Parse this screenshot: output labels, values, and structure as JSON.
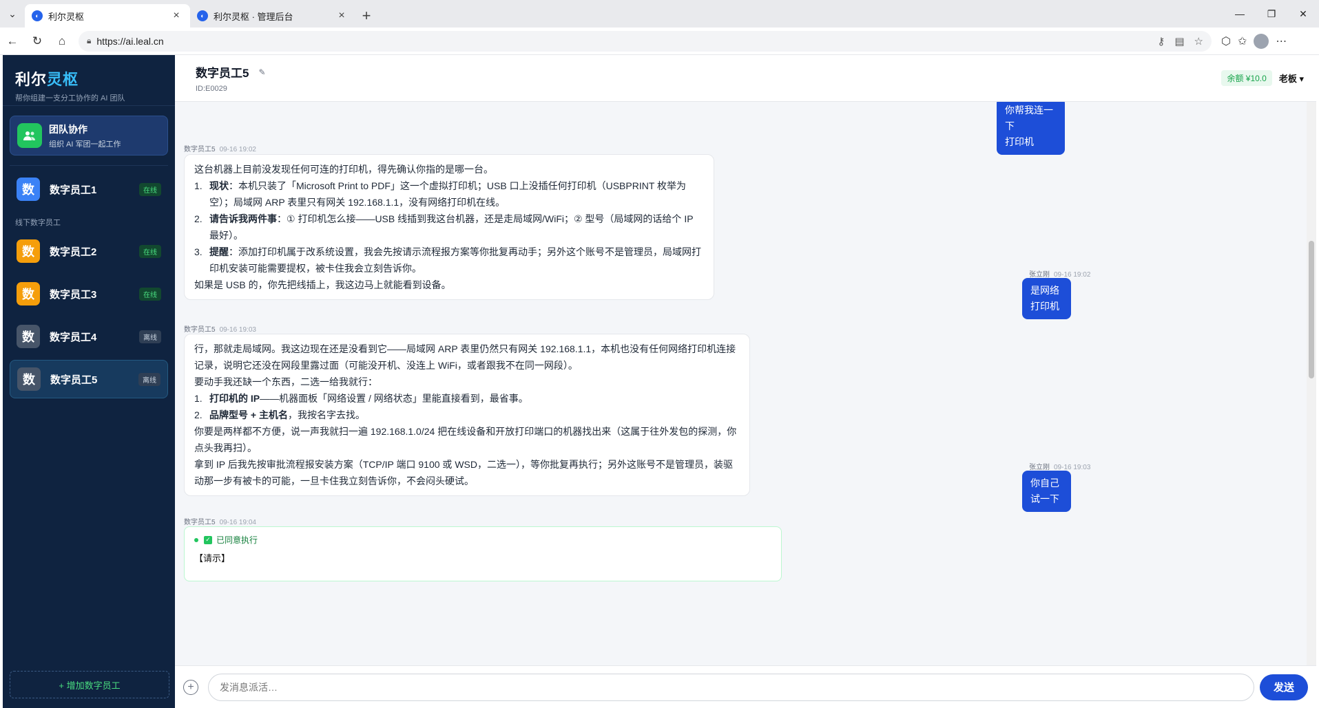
{
  "browser": {
    "tabs": [
      {
        "title": "利尔灵枢"
      },
      {
        "title": "利尔灵枢 · 管理后台"
      }
    ],
    "url": "https://ai.leal.cn"
  },
  "sidebar": {
    "brand_main": "利尔",
    "brand_accent": "灵枢",
    "brand_sub": "帮你组建一支分工协作的 AI 团队",
    "team": {
      "title": "团队协作",
      "sub": "组织 AI 军团一起工作"
    },
    "group_label": "线下数字员工",
    "employees": [
      {
        "avatar": "数",
        "name": "数字员工1",
        "status": "在线",
        "color": "#3b82f6"
      },
      {
        "avatar": "数",
        "name": "数字员工2",
        "status": "在线",
        "color": "#f59e0b"
      },
      {
        "avatar": "数",
        "name": "数字员工3",
        "status": "在线",
        "color": "#f59e0b"
      },
      {
        "avatar": "数",
        "name": "数字员工4",
        "status": "离线",
        "color": "#475569"
      },
      {
        "avatar": "数",
        "name": "数字员工5",
        "status": "离线",
        "color": "#475569"
      }
    ],
    "add_label": "+ 增加数字员工"
  },
  "header": {
    "title": "数字员工5",
    "id": "ID:E0029",
    "balance": "余额 ¥10.0",
    "user": "老板"
  },
  "chat": {
    "m0": {
      "text1": "你帮我连一下",
      "text2": "打印机"
    },
    "m1": {
      "sender": "数字员工5",
      "time": "09-16 19:02",
      "intro": "这台机器上目前没发现任何可连的打印机，得先确认你指的是哪一台。",
      "items": [
        {
          "idx": "1.",
          "bold": "现状",
          "text": "：本机只装了「Microsoft Print to PDF」这一个虚拟打印机；USB 口上没插任何打印机（USBPRINT 枚举为空）；局域网 ARP 表里只有网关 192.168.1.1，没有网络打印机在线。"
        },
        {
          "idx": "2.",
          "bold": "请告诉我两件事",
          "text": "：① 打印机怎么接——USB 线插到我这台机器，还是走局域网/WiFi；② 型号（局域网的话给个 IP 最好）。"
        },
        {
          "idx": "3.",
          "bold": "提醒",
          "text": "：添加打印机属于改系统设置，我会先按请示流程报方案等你批复再动手；另外这个账号不是管理员，局域网打印机安装可能需要提权，被卡住我会立刻告诉你。"
        }
      ],
      "outro": "如果是 USB 的，你先把线插上，我这边马上就能看到设备。"
    },
    "m2": {
      "sender": "张立刚",
      "time": "09-16 19:02",
      "text1": "是网络",
      "text2": "打印机"
    },
    "m3": {
      "sender": "数字员工5",
      "time": "09-16 19:03",
      "intro": "行，那就走局域网。我这边现在还是没看到它——局域网 ARP 表里仍然只有网关 192.168.1.1，本机也没有任何网络打印机连接记录，说明它还没在网段里露过面（可能没开机、没连上 WiFi，或者跟我不在同一网段）。",
      "need": "要动手我还缺一个东西，二选一给我就行：",
      "items": [
        {
          "idx": "1.",
          "bold": "打印机的 IP",
          "text": "——机器面板「网络设置 / 网络状态」里能直接看到，最省事。"
        },
        {
          "idx": "2.",
          "bold": "品牌型号 + 主机名",
          "text": "，我按名字去找。"
        }
      ],
      "outro1": "你要是两样都不方便，说一声我就扫一遍 192.168.1.0/24 把在线设备和开放打印端口的机器找出来（这属于往外发包的探测，你点头我再扫）。",
      "outro2": "拿到 IP 后我先按审批流程报安装方案（TCP/IP 端口 9100 或 WSD，二选一），等你批复再执行；另外这账号不是管理员，装驱动那一步有被卡的可能，一旦卡住我立刻告诉你，不会闷头硬试。"
    },
    "m4": {
      "sender": "张立刚",
      "time": "09-16 19:03",
      "text1": "你自己",
      "text2": "试一下"
    },
    "m5": {
      "sender": "数字员工5",
      "time": "09-16 19:04",
      "approved": "已同意执行",
      "body": "【请示】"
    }
  },
  "input": {
    "placeholder": "发消息派活…",
    "send": "发送"
  },
  "colors": {
    "sidebar": "#0f2340",
    "accent": "#1d4ed8",
    "online": "#4ade80"
  }
}
